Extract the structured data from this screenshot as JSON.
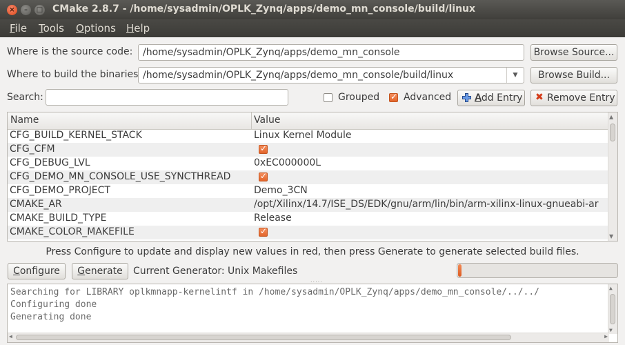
{
  "window": {
    "title": "CMake 2.8.7 - /home/sysadmin/OPLK_Zynq/apps/demo_mn_console/build/linux"
  },
  "menu": {
    "file": {
      "accel": "F",
      "rest": "ile"
    },
    "tools": {
      "accel": "T",
      "rest": "ools"
    },
    "options": {
      "accel": "O",
      "rest": "ptions"
    },
    "help": {
      "accel": "H",
      "rest": "elp"
    }
  },
  "source": {
    "label": "Where is the source code:",
    "value": "/home/sysadmin/OPLK_Zynq/apps/demo_mn_console",
    "browse_label": "Browse Source..."
  },
  "binaries": {
    "label": "Where to build the binaries:",
    "value": "/home/sysadmin/OPLK_Zynq/apps/demo_mn_console/build/linux",
    "browse_label": "Browse Build..."
  },
  "search": {
    "label": "Search:",
    "value": ""
  },
  "options": {
    "grouped": {
      "label": "Grouped",
      "checked": false
    },
    "advanced": {
      "label": "Advanced",
      "checked": true
    }
  },
  "actions": {
    "add_entry": "Add Entry",
    "remove_entry": "Remove Entry"
  },
  "table": {
    "columns": [
      "Name",
      "Value"
    ],
    "rows": [
      {
        "name": "CFG_BUILD_KERNEL_STACK",
        "value": "Linux Kernel Module",
        "type": "text"
      },
      {
        "name": "CFG_CFM",
        "value": true,
        "type": "bool"
      },
      {
        "name": "CFG_DEBUG_LVL",
        "value": "0xEC000000L",
        "type": "text"
      },
      {
        "name": "CFG_DEMO_MN_CONSOLE_USE_SYNCTHREAD",
        "value": true,
        "type": "bool"
      },
      {
        "name": "CFG_DEMO_PROJECT",
        "value": "Demo_3CN",
        "type": "text"
      },
      {
        "name": "CMAKE_AR",
        "value": "/opt/Xilinx/14.7/ISE_DS/EDK/gnu/arm/lin/bin/arm-xilinx-linux-gnueabi-ar",
        "type": "text"
      },
      {
        "name": "CMAKE_BUILD_TYPE",
        "value": "Release",
        "type": "text"
      },
      {
        "name": "CMAKE_COLOR_MAKEFILE",
        "value": true,
        "type": "bool"
      }
    ]
  },
  "info_text": "Press Configure to update and display new values in red, then press Generate to generate selected build files.",
  "bottom": {
    "configure_label": "Configure",
    "configure_accel": "C",
    "configure_rest": "onfigure",
    "generate_label": "Generate",
    "generate_accel": "G",
    "generate_rest": "enerate",
    "generator_text": "Current Generator: Unix Makefiles",
    "progress": 0.02
  },
  "output": {
    "lines": [
      "Searching for LIBRARY oplkmnapp-kernelintf in /home/sysadmin/OPLK_Zynq/apps/demo_mn_console/../../",
      "Configuring done",
      "Generating done"
    ]
  },
  "colors": {
    "accent": "#e3652b",
    "titlebar": "#403f3b",
    "window_bg": "#f2f1f0"
  },
  "icons": {
    "add": "plus-icon",
    "remove": "x-icon"
  }
}
